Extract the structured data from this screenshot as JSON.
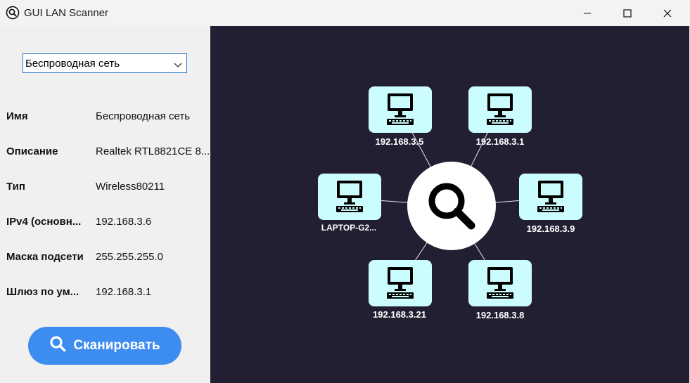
{
  "window": {
    "title": "GUI LAN Scanner",
    "icon": "magnifier-icon",
    "controls": [
      "minimize-icon",
      "maximize-icon",
      "close-icon"
    ]
  },
  "adapter_select": {
    "value": "Беспроводная сеть"
  },
  "info": [
    {
      "label": "Имя",
      "value": "Беспроводная сеть"
    },
    {
      "label": "Описание",
      "value": "Realtek RTL8821CE 8..."
    },
    {
      "label": "Тип",
      "value": "Wireless80211"
    },
    {
      "label": "IPv4 (основн...",
      "value": "192.168.3.6"
    },
    {
      "label": "Маска подсети",
      "value": "255.255.255.0"
    },
    {
      "label": "Шлюз по ум...",
      "value": "192.168.3.1"
    }
  ],
  "scan_button": {
    "label": "Сканировать",
    "icon": "search-icon"
  },
  "map": {
    "center_icon": "search-icon",
    "device_icon": "computer-icon",
    "colors": {
      "background": "#221f33",
      "node": "#ccfdfe",
      "accent": "#3d8df0"
    },
    "devices": [
      {
        "label": "192.168.3.5"
      },
      {
        "label": "192.168.3.1"
      },
      {
        "label": "LAPTOP-G2..."
      },
      {
        "label": "192.168.3.9"
      },
      {
        "label": "192.168.3.21"
      },
      {
        "label": "192.168.3.8"
      }
    ]
  }
}
